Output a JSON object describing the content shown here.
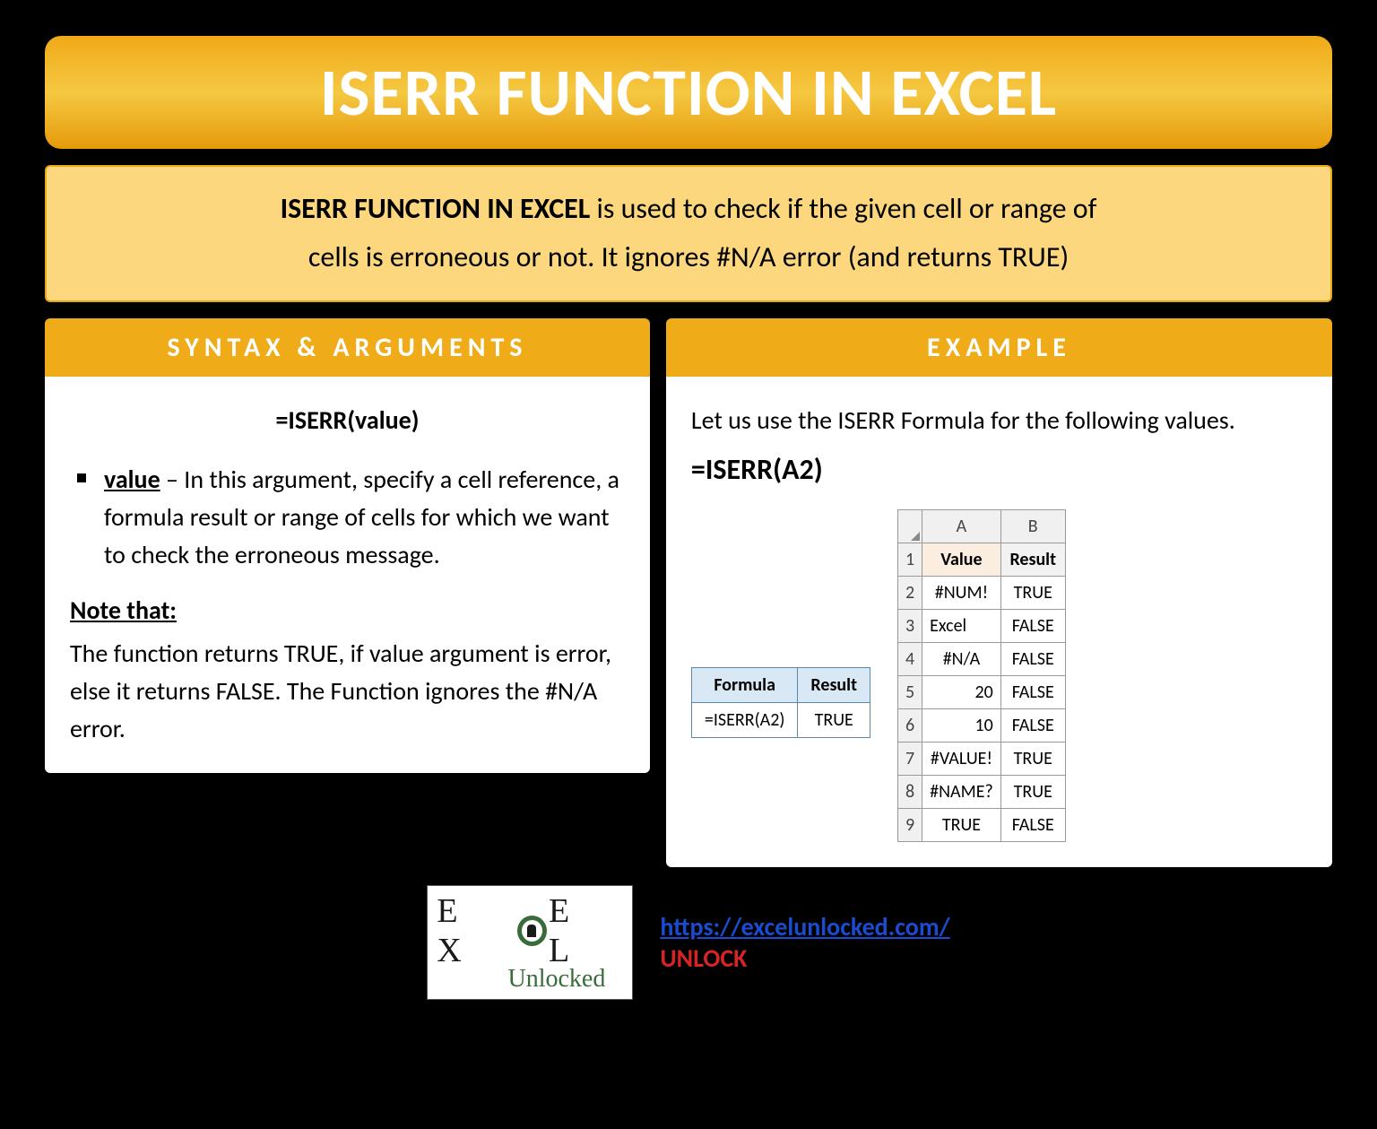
{
  "title": "ISERR FUNCTION IN EXCEL",
  "intro": {
    "bold": "ISERR FUNCTION IN EXCEL",
    "rest1": " is used to check if the given cell or range of",
    "line2": "cells is erroneous or not. It ignores #N/A error (and returns TRUE)"
  },
  "syntax": {
    "header": "SYNTAX & ARGUMENTS",
    "formula": "=ISERR(value)",
    "arg_name": "value",
    "arg_desc": " – In this argument, specify a cell reference, a formula result or range of cells for which we want to check the erroneous message.",
    "note_head": "Note that:",
    "note_body": "The function returns TRUE, if value argument is error, else it returns FALSE. The Function ignores the #N/A error."
  },
  "example": {
    "header": "EXAMPLE",
    "intro": "Let us use the ISERR Formula for the following values.",
    "formula": "=ISERR(A2)",
    "formula_table": {
      "headers": [
        "Formula",
        "Result"
      ],
      "row": [
        "=ISERR(A2)",
        "TRUE"
      ]
    },
    "grid": {
      "cols": [
        "A",
        "B"
      ],
      "header_row": [
        "Value",
        "Result"
      ],
      "rows": [
        {
          "n": "2",
          "a": "#NUM!",
          "b": "TRUE",
          "align": "c"
        },
        {
          "n": "3",
          "a": "Excel",
          "b": "FALSE",
          "align": "l"
        },
        {
          "n": "4",
          "a": "#N/A",
          "b": "FALSE",
          "align": "c"
        },
        {
          "n": "5",
          "a": "20",
          "b": "FALSE",
          "align": "r"
        },
        {
          "n": "6",
          "a": "10",
          "b": "FALSE",
          "align": "r"
        },
        {
          "n": "7",
          "a": "#VALUE!",
          "b": "TRUE",
          "align": "c"
        },
        {
          "n": "8",
          "a": "#NAME?",
          "b": "TRUE",
          "align": "c"
        },
        {
          "n": "9",
          "a": "TRUE",
          "b": "FALSE",
          "align": "c"
        }
      ]
    }
  },
  "footer": {
    "logo_top": "EX   EL",
    "logo_bottom": "Unlocked",
    "url": "https://excelunlocked.com/",
    "unlock": "UNLOCK"
  }
}
